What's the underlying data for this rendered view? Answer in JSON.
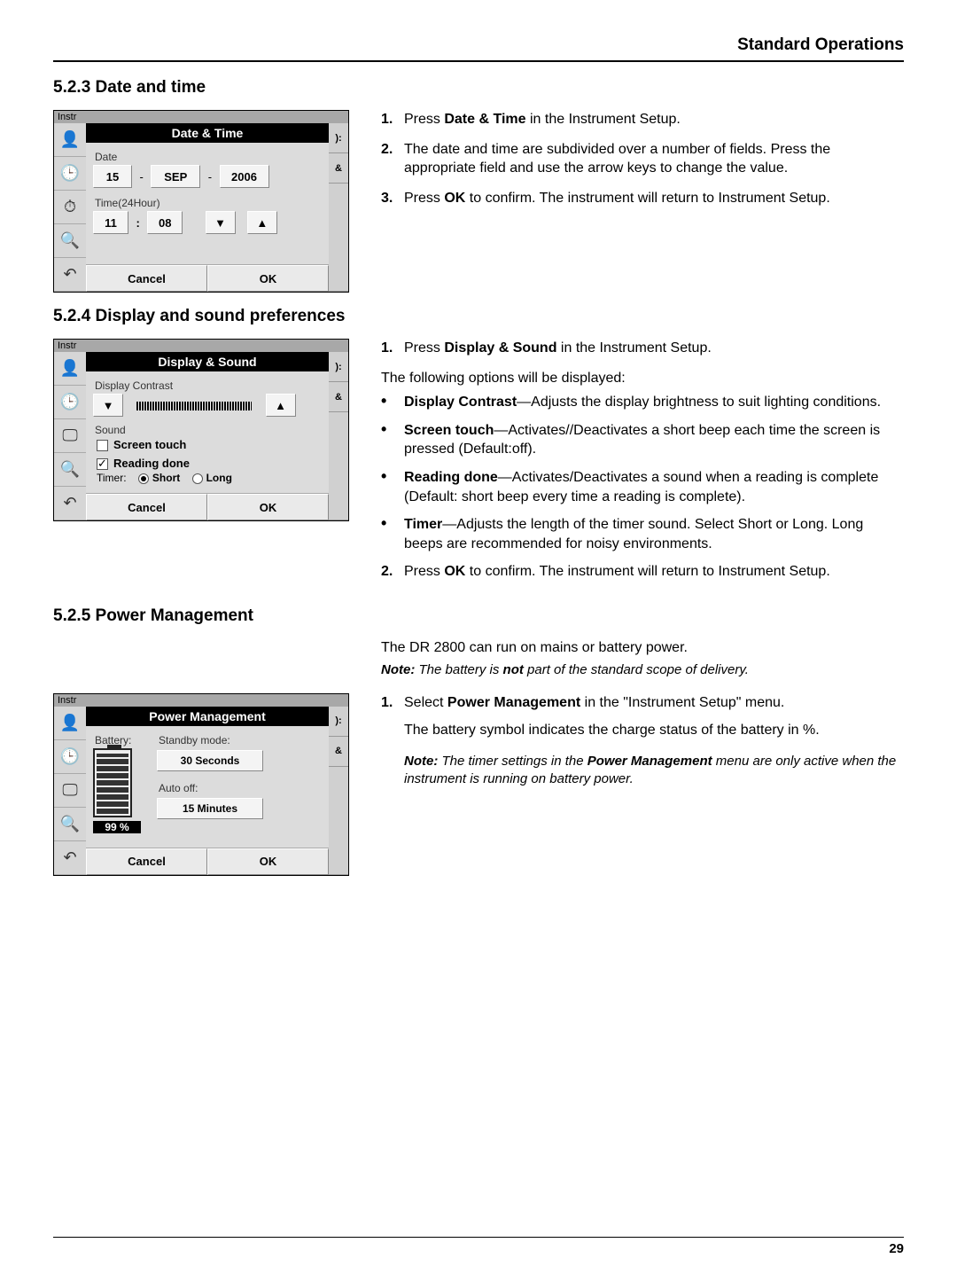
{
  "header": {
    "title": "Standard Operations"
  },
  "footer": {
    "page": "29"
  },
  "s1": {
    "heading": "5.2.3  Date and time",
    "shot": {
      "strip": "Instr",
      "title": "Date & Time",
      "date_label": "Date",
      "day": "15",
      "mon": "SEP",
      "year": "2006",
      "time_label": "Time(24Hour)",
      "hh": "11",
      "mm": "08",
      "cancel": "Cancel",
      "ok": "OK",
      "side_ampersand": "&",
      "side_right": "):"
    },
    "steps": {
      "n1": "1.",
      "t1a": "Press ",
      "t1b": "Date & Time",
      "t1c": " in the Instrument Setup.",
      "n2": "2.",
      "t2": "The date and time are subdivided over a number of fields. Press the appropriate field and use the arrow keys to change the value.",
      "n3": "3.",
      "t3a": "Press ",
      "t3b": "OK",
      "t3c": " to confirm. The instrument will return to Instrument Setup."
    }
  },
  "s2": {
    "heading": "5.2.4  Display and sound preferences",
    "shot": {
      "strip": "Instr",
      "title": "Display & Sound",
      "contrast_label": "Display Contrast",
      "sound_label": "Sound",
      "screen_touch": "Screen touch",
      "reading_done": "Reading done",
      "timer_label": "Timer:",
      "short": "Short",
      "long": "Long",
      "cancel": "Cancel",
      "ok": "OK",
      "side_ampersand": "&",
      "side_right": "):"
    },
    "intro_n": "1.",
    "intro_a": "Press ",
    "intro_b": "Display & Sound",
    "intro_c": " in the Instrument Setup.",
    "lead": "The following options will be displayed:",
    "b1a": "Display Contrast",
    "b1b": "—Adjusts the display brightness to suit lighting conditions.",
    "b2a": "Screen touch",
    "b2b": "—Activates//Deactivates a short beep each time the screen is pressed (Default:off).",
    "b3a": "Reading done",
    "b3b": "—Activates/Deactivates a sound when a reading is complete (Default: short beep every time a reading is complete).",
    "b4a": "Timer",
    "b4b": "—Adjusts the length of the timer sound. Select Short or Long. Long beeps are recommended for noisy environments.",
    "step2_n": "2.",
    "step2_a": "Press ",
    "step2_b": "OK",
    "step2_c": " to confirm. The instrument will return to Instrument Setup."
  },
  "s3": {
    "heading": "5.2.5  Power Management",
    "para1": "The DR 2800 can run on mains or battery power.",
    "note_pre": "Note: ",
    "note_a": "The battery is ",
    "note_b": "not",
    "note_c": " part of the standard scope of delivery.",
    "shot": {
      "strip": "Instr",
      "title": "Power Management",
      "battery_label": "Battery:",
      "standby_label": "Standby mode:",
      "standby_val": "30 Seconds",
      "auto_label": "Auto off:",
      "auto_val": "15 Minutes",
      "pct": "99 %",
      "cancel": "Cancel",
      "ok": "OK",
      "side_ampersand": "&",
      "side_right": "):"
    },
    "step1_n": "1.",
    "step1_a": "Select ",
    "step1_b": "Power Management",
    "step1_c": " in the \"Instrument Setup\" menu.",
    "step1_para": "The battery symbol indicates the charge status of the battery in %.",
    "note2_pre": "Note: ",
    "note2_a": "The timer settings in the ",
    "note2_b": "Power Management",
    "note2_c": " menu are only active when the instrument is running on battery power."
  }
}
